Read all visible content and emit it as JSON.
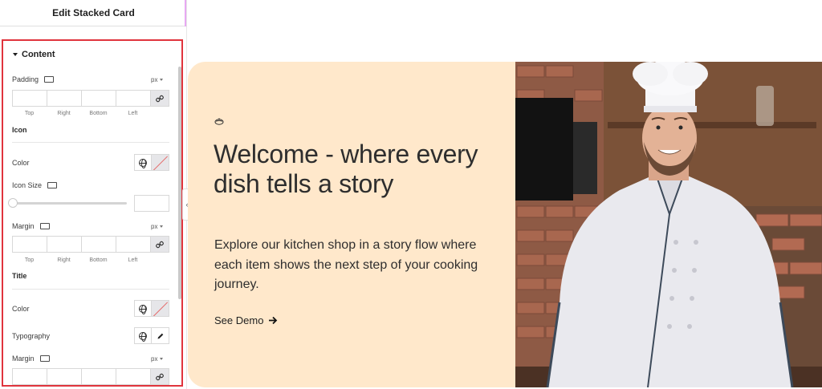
{
  "panel": {
    "title": "Edit Stacked Card",
    "section": "Content",
    "padding": {
      "label": "Padding",
      "unit": "px"
    },
    "dim_labels": [
      "Top",
      "Right",
      "Bottom",
      "Left"
    ],
    "icon_group": {
      "heading": "Icon",
      "color_label": "Color",
      "size_label": "Icon Size",
      "margin_label": "Margin",
      "margin_unit": "px"
    },
    "title_group": {
      "heading": "Title",
      "color_label": "Color",
      "typography_label": "Typography",
      "margin_label": "Margin",
      "margin_unit": "px"
    }
  },
  "preview": {
    "title": "Welcome - where every dish tells a story",
    "text": "Explore our kitchen shop in a story flow where each item shows the next step of your cooking journey.",
    "link": "See Demo",
    "background": "#ffe8cb",
    "image_subject": "chef portrait"
  },
  "icons": {
    "monitor": "monitor-icon",
    "link": "link-icon",
    "globe": "globe-icon",
    "pencil": "pencil-icon",
    "arrow": "arrow-right-icon"
  },
  "colors": {
    "highlight_border": "#e0343d",
    "accent": "#e7a9f2"
  }
}
